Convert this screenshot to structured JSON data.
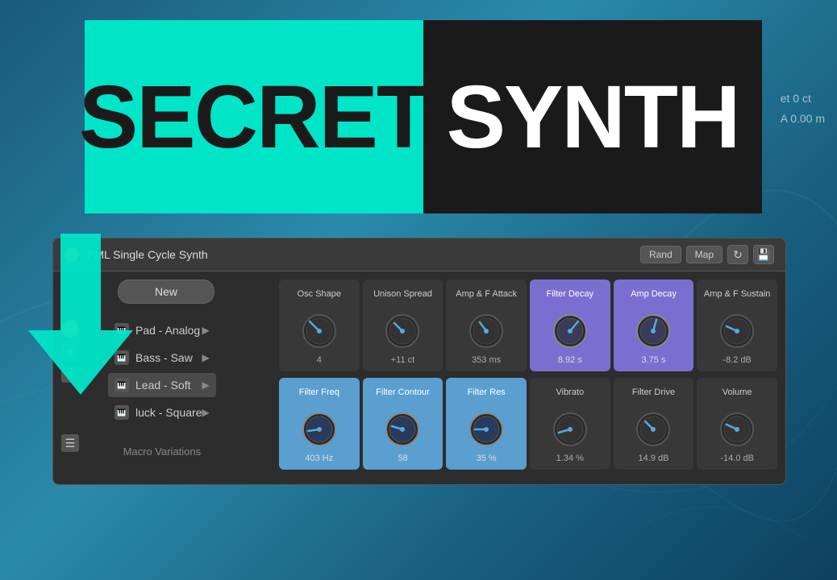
{
  "background": {
    "color": "#1a6080"
  },
  "header": {
    "secret_text": "SECRET",
    "synth_text": "SYNTH"
  },
  "right_info": {
    "line1": "et 0 ct",
    "line2": "A 0.00 m"
  },
  "panel": {
    "title": "PML Single Cycle Synth",
    "rand_btn": "Rand",
    "map_btn": "Map",
    "new_btn": "New"
  },
  "presets": [
    {
      "name": "Pad - Analog",
      "active": false
    },
    {
      "name": "Bass - Saw",
      "active": false
    },
    {
      "name": "Lead - Soft",
      "active": true
    },
    {
      "name": "luck - Square",
      "active": false
    }
  ],
  "macro": {
    "label": "Macro Variations"
  },
  "knob_row1": [
    {
      "label": "Osc Shape",
      "value": "4",
      "highlight": "none",
      "angle": -30
    },
    {
      "label": "Unison Spread",
      "value": "+11 ct",
      "highlight": "none",
      "angle": -20
    },
    {
      "label": "Amp & F Attack",
      "value": "353 ms",
      "highlight": "none",
      "angle": -10
    },
    {
      "label": "Filter Decay",
      "value": "8.92 s",
      "highlight": "purple",
      "angle": 60
    },
    {
      "label": "Amp Decay",
      "value": "3.75 s",
      "highlight": "purple",
      "angle": 20
    },
    {
      "label": "Amp & F Sustain",
      "value": "-8.2 dB",
      "highlight": "none",
      "angle": -40
    }
  ],
  "knob_row2": [
    {
      "label": "Filter Freq",
      "value": "403 Hz",
      "highlight": "blue",
      "angle": -60
    },
    {
      "label": "Filter Contour",
      "value": "58",
      "highlight": "blue",
      "angle": -30
    },
    {
      "label": "Filter Res",
      "value": "35 %",
      "highlight": "blue",
      "angle": -50
    },
    {
      "label": "Vibrato",
      "value": "1.34 %",
      "highlight": "none",
      "angle": -80
    },
    {
      "label": "Filter Drive",
      "value": "14.9 dB",
      "highlight": "none",
      "angle": -20
    },
    {
      "label": "Volume",
      "value": "-14.0 dB",
      "highlight": "none",
      "angle": -40
    }
  ]
}
